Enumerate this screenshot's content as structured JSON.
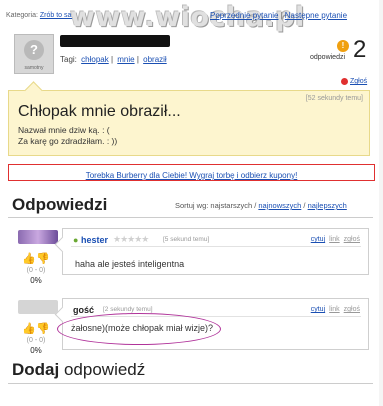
{
  "header": {
    "category_label": "Kategoria:",
    "category_value": "Zrób to sam",
    "watermark": "www.wiocha.pl",
    "prev_question": "Poprzednie pytanie",
    "next_question": "Następne pytanie"
  },
  "question": {
    "avatar_label": "samotny",
    "tags_label": "Tagi:",
    "tags": [
      "chłopak",
      "mnie",
      "obraził"
    ],
    "answers_count": "2",
    "answers_label": "odpowiedzi",
    "report": "Zgłoś",
    "time": "[52 sekundy temu]",
    "title": "Chłopak mnie obraził...",
    "body_line1": "Nazwał mnie dziw ką. : (",
    "body_line2": "Za karę go zdradziłam. : ))"
  },
  "promo": "Torebka Burberry dla Ciebie! Wygraj torbę i odbierz kupony!",
  "answers_section": {
    "heading": "Odpowiedzi",
    "sort_label": "Sortuj wg: najstarszych /",
    "sort_newest": "najnowszych",
    "sort_best": "najlepszych",
    "sort_divider": "/"
  },
  "answers": [
    {
      "author": "hester",
      "stars": "★★★★★",
      "time": "[5 sekund temu]",
      "action_quote": "cytuj",
      "action_link": "link",
      "action_report": "zgłoś",
      "text": "haha ale jesteś inteligentna",
      "votes": "(0 - 0)",
      "percent": "0%"
    },
    {
      "author": "gość",
      "time": "[2 sekundy temu]",
      "action_quote": "cytuj",
      "action_link": "link",
      "action_report": "zgłoś",
      "text": "żałosne)(może chłopak miał wizje)?",
      "votes": "(0 - 0)",
      "percent": "0%"
    }
  ],
  "add_answer": {
    "heading_bold": "Dodaj",
    "heading_rest": "odpowiedź"
  },
  "icons": {
    "thumb_up": "thumb-up-icon",
    "thumb_down": "thumb-down-icon",
    "report": "alert-icon",
    "answers_bubble": "exclamation-bubble-icon"
  },
  "colors": {
    "link": "#1a4fb3",
    "question_bg": "#fdf5cf",
    "promo_border": "#e03030",
    "highlight_ellipse": "#b0339a"
  }
}
